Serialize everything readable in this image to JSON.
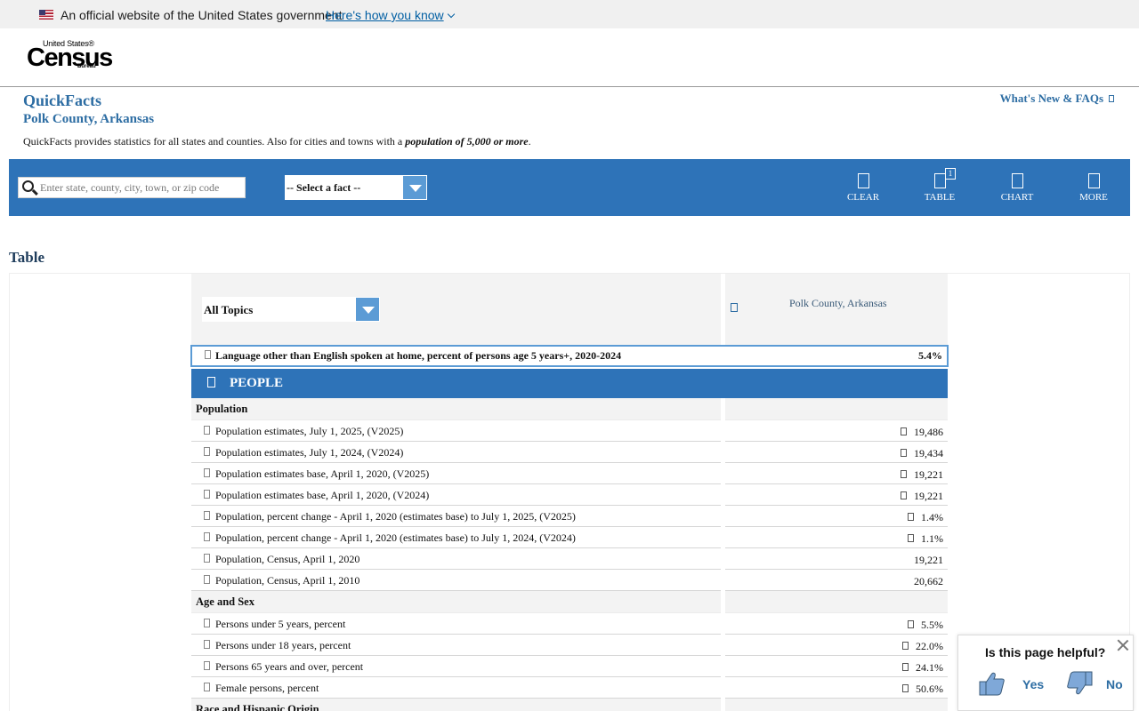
{
  "gov_banner": {
    "text": "An official website of the United States government",
    "link": "Here's how you know"
  },
  "logo": {
    "top": "United States®",
    "name": "Census",
    "bureau": "Bureau"
  },
  "quickfacts": {
    "title": "QuickFacts",
    "location": "Polk County, Arkansas",
    "description_prefix": "QuickFacts provides statistics for all states and counties. Also for cities and towns with a ",
    "description_emphasis": "population of 5,000 or more",
    "description_suffix": ".",
    "whats_new": "What's New & FAQs"
  },
  "toolbar": {
    "search_placeholder": "Enter state, county, city, town, or zip code",
    "fact_select": "-- Select a fact --",
    "clear": "CLEAR",
    "table": "TABLE",
    "table_badge": "1",
    "chart": "CHART",
    "more": "MORE"
  },
  "table": {
    "title": "Table",
    "topics_select": "All Topics",
    "column_header": "Polk County, Arkansas",
    "highlight": {
      "label": "Language other than English spoken at home, percent of persons age 5 years+, 2020-2024",
      "value": "5.4%"
    },
    "section": "PEOPLE",
    "rows": [
      {
        "type": "section",
        "label": "Population"
      },
      {
        "label": "Population estimates, July 1, 2025, (V2025)",
        "value": "19,486",
        "flag": true
      },
      {
        "label": "Population estimates, July 1, 2024, (V2024)",
        "value": "19,434",
        "flag": true
      },
      {
        "label": "Population estimates base, April 1, 2020, (V2025)",
        "value": "19,221",
        "flag": true
      },
      {
        "label": "Population estimates base, April 1, 2020, (V2024)",
        "value": "19,221",
        "flag": true
      },
      {
        "label": "Population, percent change - April 1, 2020 (estimates base) to July 1, 2025, (V2025)",
        "value": "1.4%",
        "flag": true
      },
      {
        "label": "Population, percent change - April 1, 2020 (estimates base) to July 1, 2024, (V2024)",
        "value": "1.1%",
        "flag": true
      },
      {
        "label": "Population, Census, April 1, 2020",
        "value": "19,221",
        "flag": false
      },
      {
        "label": "Population, Census, April 1, 2010",
        "value": "20,662",
        "flag": false
      },
      {
        "type": "section",
        "label": "Age and Sex"
      },
      {
        "label": "Persons under 5 years, percent",
        "value": "5.5%",
        "flag": true
      },
      {
        "label": "Persons under 18 years, percent",
        "value": "22.0%",
        "flag": true
      },
      {
        "label": "Persons 65 years and over, percent",
        "value": "24.1%",
        "flag": true
      },
      {
        "label": "Female persons, percent",
        "value": "50.6%",
        "flag": true
      },
      {
        "type": "section",
        "label": "Race and Hispanic Origin"
      }
    ]
  },
  "feedback": {
    "question": "Is this page helpful?",
    "yes": "Yes",
    "no": "No"
  }
}
